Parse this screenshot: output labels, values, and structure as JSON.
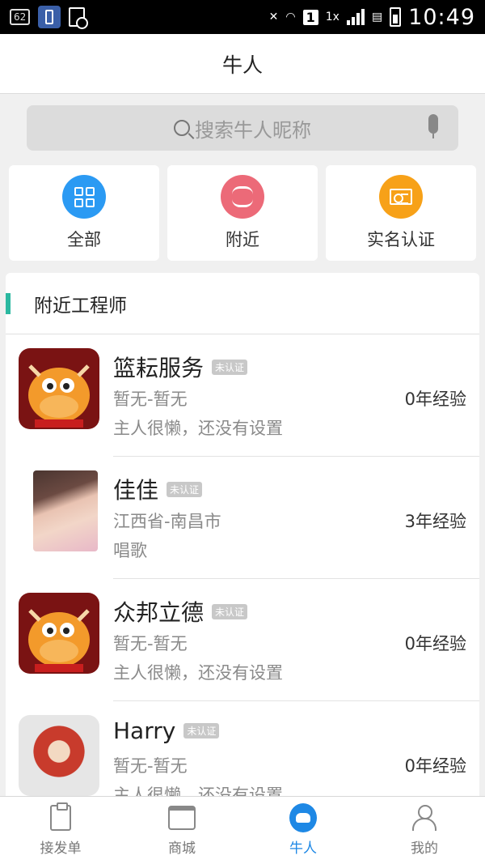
{
  "status_bar": {
    "notif_count": "62",
    "sim_slot": "1",
    "network": "1x",
    "time": "10:49"
  },
  "header": {
    "title": "牛人"
  },
  "search": {
    "placeholder": "搜索牛人昵称"
  },
  "categories": [
    {
      "label": "全部",
      "icon": "grid-icon",
      "color": "#2b9af3"
    },
    {
      "label": "附近",
      "icon": "route-icon",
      "color": "#ec6a78"
    },
    {
      "label": "实名认证",
      "icon": "id-card-icon",
      "color": "#f7a118"
    }
  ],
  "section": {
    "title": "附近工程师",
    "accent": "#2bb8a0"
  },
  "engineers": [
    {
      "name": "篮耘服务",
      "badge": "未认证",
      "location": "暂无-暂无",
      "desc": "主人很懒，还没有设置",
      "experience": "0年经验",
      "avatar": "cow-mascot"
    },
    {
      "name": "佳佳",
      "badge": "未认证",
      "location": "江西省-南昌市",
      "desc": "唱歌",
      "experience": "3年经验",
      "avatar": "photo-girl"
    },
    {
      "name": "众邦立德",
      "badge": "未认证",
      "location": "暂无-暂无",
      "desc": "主人很懒，还没有设置",
      "experience": "0年经验",
      "avatar": "cow-mascot"
    },
    {
      "name": "Harry",
      "badge": "未认证",
      "location": "暂无-暂无",
      "desc": "主人很懒，还没有设置",
      "experience": "0年经验",
      "avatar": "photo-monkey"
    }
  ],
  "bottom_nav": [
    {
      "label": "接发单",
      "icon": "clipboard-icon",
      "active": false
    },
    {
      "label": "商城",
      "icon": "shop-icon",
      "active": false
    },
    {
      "label": "牛人",
      "icon": "niuren-icon",
      "active": true
    },
    {
      "label": "我的",
      "icon": "person-icon",
      "active": false
    }
  ],
  "colors": {
    "active": "#1e88e5",
    "inactive": "#777777"
  }
}
